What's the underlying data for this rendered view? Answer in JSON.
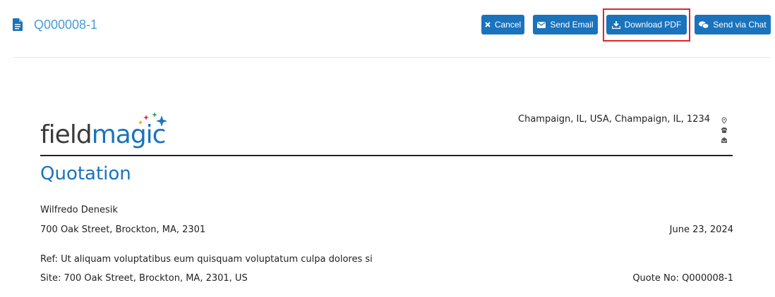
{
  "header": {
    "doc_id": "Q000008-1",
    "icons": {
      "doc": "document-icon",
      "cancel": "x-icon",
      "email": "envelope-icon",
      "pdf": "download-icon",
      "chat": "chat-bubbles-icon"
    },
    "buttons": {
      "cancel": "Cancel",
      "send_email": "Send Email",
      "download_pdf": "Download PDF",
      "send_chat": "Send via Chat"
    }
  },
  "colors": {
    "accent": "#1a73bd",
    "title": "#4a9bd6",
    "highlight": "#e0262b"
  },
  "document": {
    "logo": {
      "part1": "field",
      "part2": "magic"
    },
    "company_address": "Champaign, IL, USA, Champaign, IL, 1234",
    "heading": "Quotation",
    "customer_name": "Wilfredo Denesik",
    "customer_address": "700 Oak Street, Brockton, MA, 2301",
    "date": "June 23, 2024",
    "ref": "Ref: Ut aliquam voluptatibus eum quisquam voluptatum culpa dolores si",
    "site": "Site: 700 Oak Street, Brockton, MA, 2301, US",
    "quote_no": "Quote No: Q000008-1"
  }
}
